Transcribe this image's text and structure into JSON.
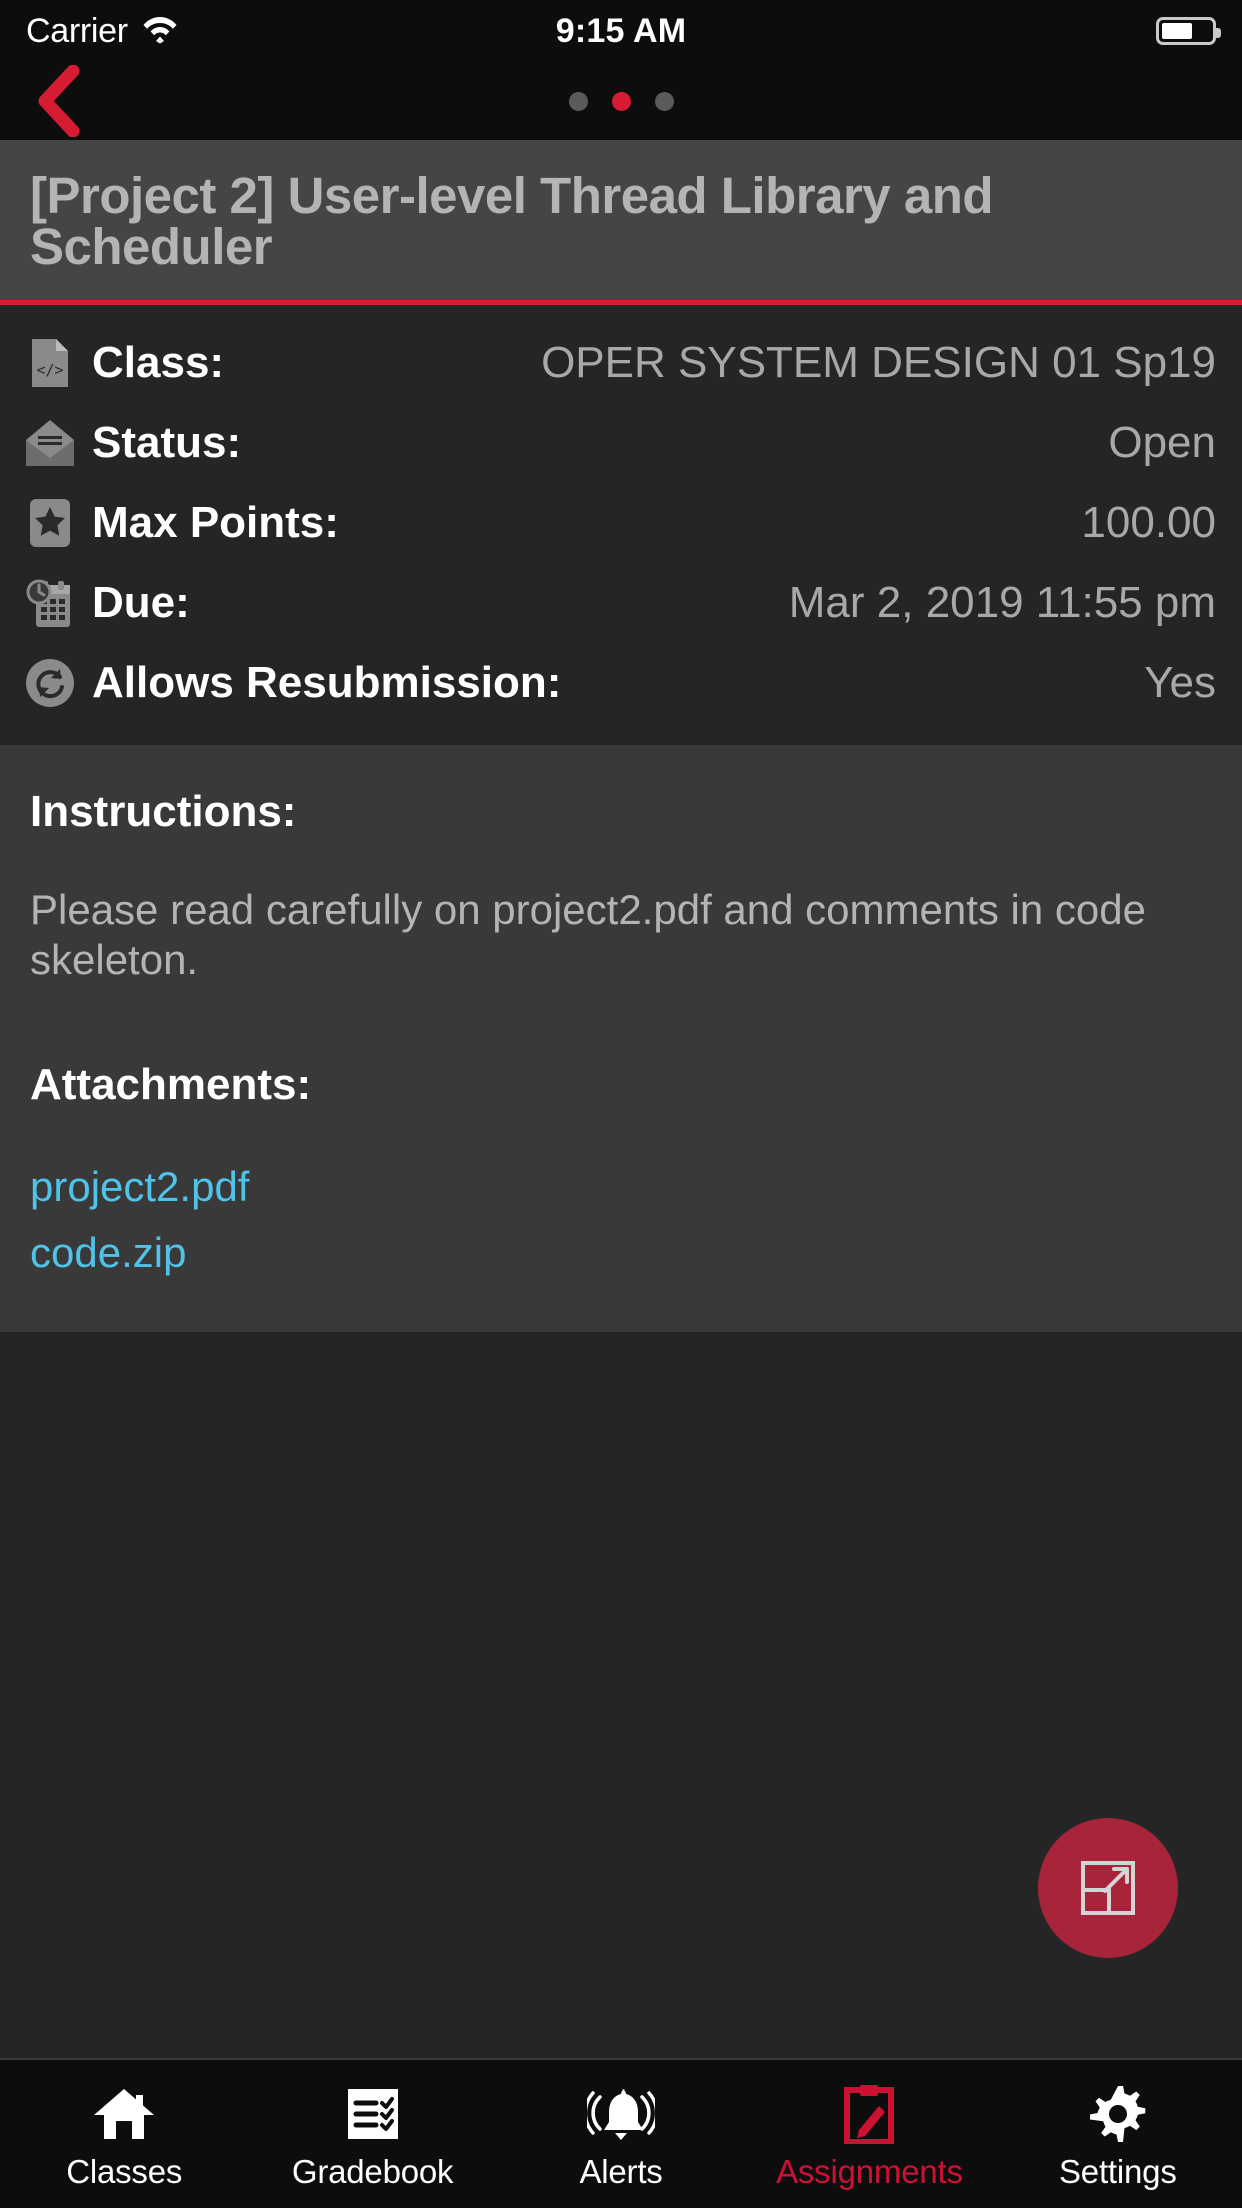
{
  "status_bar": {
    "carrier": "Carrier",
    "wifi_icon": "wifi-icon",
    "time": "9:15 AM",
    "battery_icon": "battery-icon"
  },
  "nav": {
    "back_icon": "chevron-left-icon",
    "pages": [
      "page-dot-1",
      "page-dot-2",
      "page-dot-3"
    ],
    "active_page_index": 1,
    "accent_color": "#d51c33"
  },
  "header": {
    "title": "[Project 2] User-level Thread Library and Scheduler"
  },
  "details": [
    {
      "icon": "code-file-icon",
      "label": "Class:",
      "value": "OPER SYSTEM DESIGN 01 Sp19"
    },
    {
      "icon": "open-envelope-icon",
      "label": "Status:",
      "value": "Open"
    },
    {
      "icon": "star-icon",
      "label": "Max Points:",
      "value": "100.00"
    },
    {
      "icon": "calendar-clock-icon",
      "label": "Due:",
      "value": "Mar 2, 2019 11:55 pm"
    },
    {
      "icon": "refresh-icon",
      "label": "Allows Resubmission:",
      "value": "Yes"
    }
  ],
  "instructions": {
    "heading": "Instructions:",
    "body": "Please read carefully on project2.pdf and comments in code skeleton."
  },
  "attachments": {
    "heading": "Attachments:",
    "files": [
      "project2.pdf",
      "code.zip"
    ],
    "link_color": "#4fc3e8"
  },
  "fab": {
    "icon": "expand-icon",
    "color": "#a8243a"
  },
  "tabbar": {
    "active_index": 3,
    "active_color": "#cc1133",
    "items": [
      {
        "icon": "home-icon",
        "label": "Classes"
      },
      {
        "icon": "checklist-icon",
        "label": "Gradebook"
      },
      {
        "icon": "bell-icon",
        "label": "Alerts"
      },
      {
        "icon": "clipboard-pencil-icon",
        "label": "Assignments"
      },
      {
        "icon": "gear-icon",
        "label": "Settings"
      }
    ]
  }
}
